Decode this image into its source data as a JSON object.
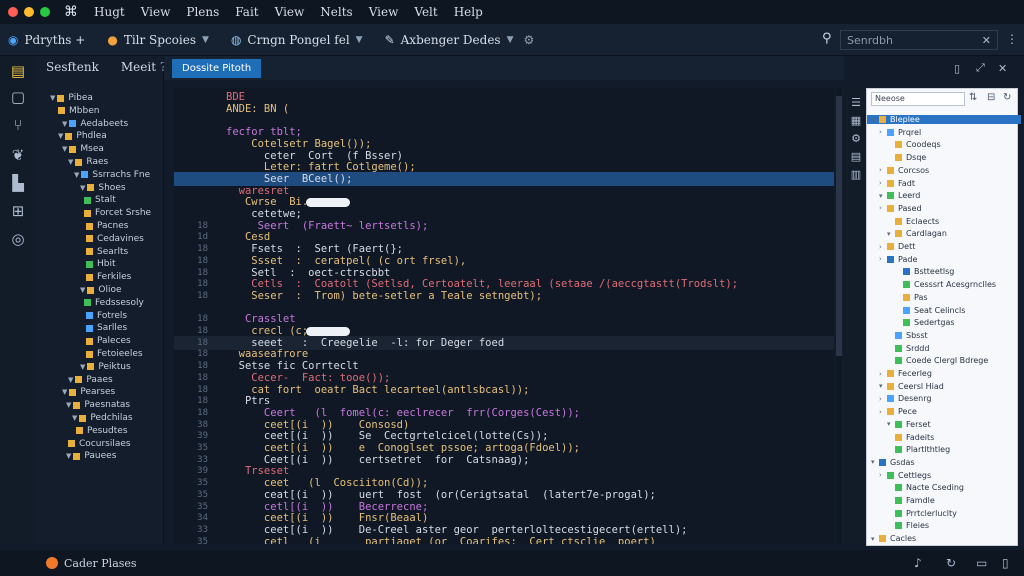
{
  "menu": [
    "Hugt",
    "View",
    "Plens",
    "Fait",
    "View",
    "Nelts",
    "View",
    "Velt",
    "Help"
  ],
  "toolbar": {
    "project": "Pdryths +",
    "item1": "Tilr Spcoies",
    "item2": "Crngn Pongel fel",
    "item3": "Axbenger Dedes",
    "search_placeholder": "Senrdbh"
  },
  "explorer": {
    "tab1": "Sesftenk",
    "tab2": "Meeit",
    "items": [
      "Pibea",
      "Mbben",
      "Aedabeets",
      "Phdlea",
      "Msea",
      "Raes",
      "Ssrrachs Fne",
      "Shoes",
      "Stalt",
      "Forcet Srshe",
      "Pacnes",
      "Cedavines",
      "Searlts",
      "Hbit",
      "Ferkiles",
      "Olioe",
      "Fedssesoly",
      "Fotrels",
      "Sarlles",
      "Paleces",
      "Fetoieeles",
      "Peiktus",
      "Paaes",
      "Pearses",
      "Paesnatas",
      "Pedchilas",
      "Pesudtes",
      "Cocursilaes",
      "Pauees"
    ]
  },
  "editor": {
    "active_tab": "Dossite Pitoth",
    "lines": [
      {
        "n": "",
        "t": "BDE"
      },
      {
        "n": "",
        "t": "ANDE: BN ("
      },
      {
        "n": "",
        "t": ""
      },
      {
        "n": "",
        "t": "fecfor tblt;"
      },
      {
        "n": "",
        "t": "    Cotelsetr Bagel());"
      },
      {
        "n": "",
        "t": "      ceter  Cort  (f Bsser)"
      },
      {
        "n": "",
        "t": "      Leter: fatrt Cotlgeme();"
      },
      {
        "n": "",
        "t": "      Seer  BCeel();"
      },
      {
        "n": "",
        "t": "  waresret"
      },
      {
        "n": "",
        "t": "   Cwrse  Bi."
      },
      {
        "n": "",
        "t": "    cetetwe;"
      },
      {
        "n": "18",
        "t": "     Seert  (Fraett~ lertsetls);"
      },
      {
        "n": "1d",
        "t": "   Cesd"
      },
      {
        "n": "18",
        "t": "    Fsets  :  Sert (Faert(};"
      },
      {
        "n": "18",
        "t": "    Ssset  :  ceratpel( (c ort frsel),"
      },
      {
        "n": "18",
        "t": "    Setl  :  oect-ctrscbbt"
      },
      {
        "n": "18",
        "t": "    Cetls  :  Coatolt (Setlsd, Certoatelt, leeraal (setaae /(aeccgtastt(Trodslt);"
      },
      {
        "n": "18",
        "t": "    Seser  :  Trom) bete-setler a Teale setngebt);"
      },
      {
        "n": "",
        "t": ""
      },
      {
        "n": "18",
        "t": "   Crasslet"
      },
      {
        "n": "18",
        "t": "    crecl (c;"
      },
      {
        "n": "18",
        "t": "    seeet   :  Creegelie  -l: for Deger foed"
      },
      {
        "n": "18",
        "t": "  waaseafrore"
      },
      {
        "n": "18",
        "t": "  Setse fic Corrteclt"
      },
      {
        "n": "18",
        "t": "    Cecer-  Fact: tooe());"
      },
      {
        "n": "18",
        "t": "    cat fort  oeatr Bact lecarteel(antlsbcasl));"
      },
      {
        "n": "18",
        "t": "   Ptrs"
      },
      {
        "n": "18",
        "t": "      Ceert   (l  fomel(c: eeclrecer  frr(Corges(Cest));"
      },
      {
        "n": "38",
        "t": "      ceet[(i  ))    Consosd)"
      },
      {
        "n": "39",
        "t": "      ceet[(i  ))    Se  Cectgrtelcicel(lotte(Cs));"
      },
      {
        "n": "35",
        "t": "      ceet[(i  ))    e  Conoglset pssoe; artoga(Fdoel));"
      },
      {
        "n": "33",
        "t": "      Ceet[(i  ))    certsetret  for  Catsnaag);"
      },
      {
        "n": "39",
        "t": "   Trseset"
      },
      {
        "n": "35",
        "t": "      ceet   (l  Cosciiton(Cd));"
      },
      {
        "n": "35",
        "t": "      ceat[(i  ))    uert  fost  (or(Cerigtsatal  (latert7e-progal);"
      },
      {
        "n": "35",
        "t": "      cetl[(i  ))    Becerrecne;"
      },
      {
        "n": "34",
        "t": "      ceet[(i  ))    Fnsr(Beaal)"
      },
      {
        "n": "33",
        "t": "      ceet[(i  ))    De-Creel aster geor  perterloltecestigecert(ertell);"
      },
      {
        "n": "35",
        "t": "      cetl   (i       partiaget (or  Coarifes:  Cert_ctsclie  poert)"
      }
    ]
  },
  "outline": {
    "search": "Neeose",
    "items": [
      "Bleplee",
      "Prqrel",
      "Coodeqs",
      "Dsqe",
      "Corcsos",
      "Fadt",
      "Leerd",
      "Pased",
      "Eclaects",
      "Cardlagan",
      "Dett",
      "Pade",
      "Bstteetlsg",
      "Cesssrt Acesgrnclles",
      "Pas",
      "Seat Celincls",
      "Sedertgas",
      "Sbsst",
      "Srddd",
      "Coede Clergl Bdrege",
      "Fecerleg",
      "Ceersl Hiad",
      "Desenrg",
      "Pece",
      "Ferset",
      "Fadeits",
      "Plartlthtleg",
      "Gsdas",
      "Cettlegs",
      "Nacte Cseding",
      "Famdle",
      "Prrtclerluclty",
      "Fleies",
      "Cacles"
    ]
  },
  "status": {
    "label": "Cader Plases"
  },
  "colors": {
    "accent": "#1f6fb8",
    "selection": "#1f4c80"
  }
}
